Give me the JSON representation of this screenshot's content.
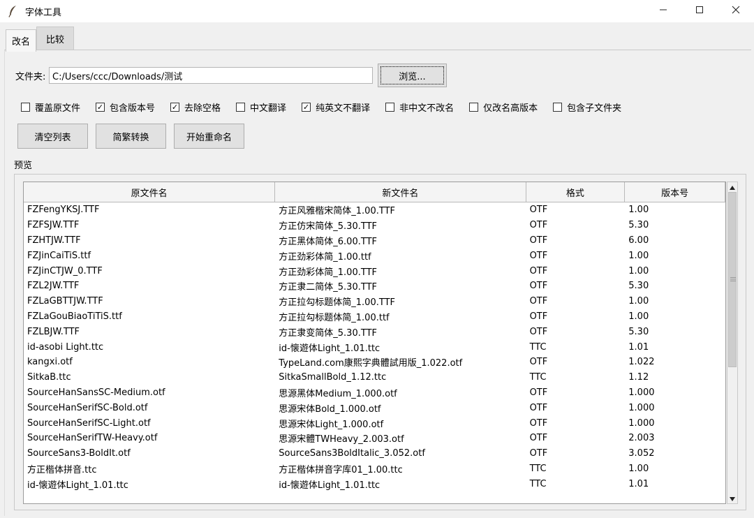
{
  "window": {
    "title": "字体工具",
    "icon": "feather-icon"
  },
  "tabs": [
    {
      "label": "改名",
      "active": true
    },
    {
      "label": "比较",
      "active": false
    }
  ],
  "folder": {
    "label": "文件夹:",
    "value": "C:/Users/ccc/Downloads/测试",
    "browse_label": "浏览..."
  },
  "options": [
    {
      "label": "覆盖原文件",
      "checked": false
    },
    {
      "label": "包含版本号",
      "checked": true
    },
    {
      "label": "去除空格",
      "checked": true
    },
    {
      "label": "中文翻译",
      "checked": false
    },
    {
      "label": "纯英文不翻译",
      "checked": true
    },
    {
      "label": "非中文不改名",
      "checked": false
    },
    {
      "label": "仅改名高版本",
      "checked": false
    },
    {
      "label": "包含子文件夹",
      "checked": false
    }
  ],
  "actions": {
    "clear_label": "清空列表",
    "convert_label": "简繁转换",
    "rename_label": "开始重命名"
  },
  "preview": {
    "label": "预览",
    "columns": [
      "原文件名",
      "新文件名",
      "格式",
      "版本号"
    ],
    "rows": [
      [
        "FZFengYKSJ.TTF",
        "方正风雅楷宋简体_1.00.TTF",
        "OTF",
        "1.00"
      ],
      [
        "FZFSJW.TTF",
        "方正仿宋简体_5.30.TTF",
        "OTF",
        "5.30"
      ],
      [
        "FZHTJW.TTF",
        "方正黑体简体_6.00.TTF",
        "OTF",
        "6.00"
      ],
      [
        "FZJinCaiTiS.ttf",
        "方正劲彩体简_1.00.ttf",
        "OTF",
        "1.00"
      ],
      [
        "FZJinCTJW_0.TTF",
        "方正劲彩体简_1.00.TTF",
        "OTF",
        "1.00"
      ],
      [
        "FZL2JW.TTF",
        "方正隶二简体_5.30.TTF",
        "OTF",
        "5.30"
      ],
      [
        "FZLaGBTTJW.TTF",
        "方正拉勾标题体简_1.00.TTF",
        "OTF",
        "1.00"
      ],
      [
        "FZLaGouBiaoTiTiS.ttf",
        "方正拉勾标题体简_1.00.ttf",
        "OTF",
        "1.00"
      ],
      [
        "FZLBJW.TTF",
        "方正隶变简体_5.30.TTF",
        "OTF",
        "5.30"
      ],
      [
        "id-asobi Light.ttc",
        "id-懐遊体Light_1.01.ttc",
        "TTC",
        "1.01"
      ],
      [
        "kangxi.otf",
        "TypeLand.com康熙字典體試用版_1.022.otf",
        "OTF",
        "1.022"
      ],
      [
        "SitkaB.ttc",
        "SitkaSmallBold_1.12.ttc",
        "TTC",
        "1.12"
      ],
      [
        "SourceHanSansSC-Medium.otf",
        "思源黑体Medium_1.000.otf",
        "OTF",
        "1.000"
      ],
      [
        "SourceHanSerifSC-Bold.otf",
        "思源宋体Bold_1.000.otf",
        "OTF",
        "1.000"
      ],
      [
        "SourceHanSerifSC-Light.otf",
        "思源宋体Light_1.000.otf",
        "OTF",
        "1.000"
      ],
      [
        "SourceHanSerifTW-Heavy.otf",
        "思源宋體TWHeavy_2.003.otf",
        "OTF",
        "2.003"
      ],
      [
        "SourceSans3-BoldIt.otf",
        "SourceSans3BoldItalic_3.052.otf",
        "OTF",
        "3.052"
      ],
      [
        "方正楷体拼音.ttc",
        "方正楷体拼音字库01_1.00.ttc",
        "TTC",
        "1.00"
      ],
      [
        "id-懐遊体Light_1.01.ttc",
        "id-懐遊体Light_1.01.ttc",
        "TTC",
        "1.01"
      ]
    ],
    "scroll": {
      "thumb_start_fraction": 0.0,
      "thumb_size_fraction": 0.58
    }
  },
  "colors": {
    "window_bg": "#f0f0f0",
    "button_bg": "#e1e1e1",
    "border": "#adadad"
  }
}
